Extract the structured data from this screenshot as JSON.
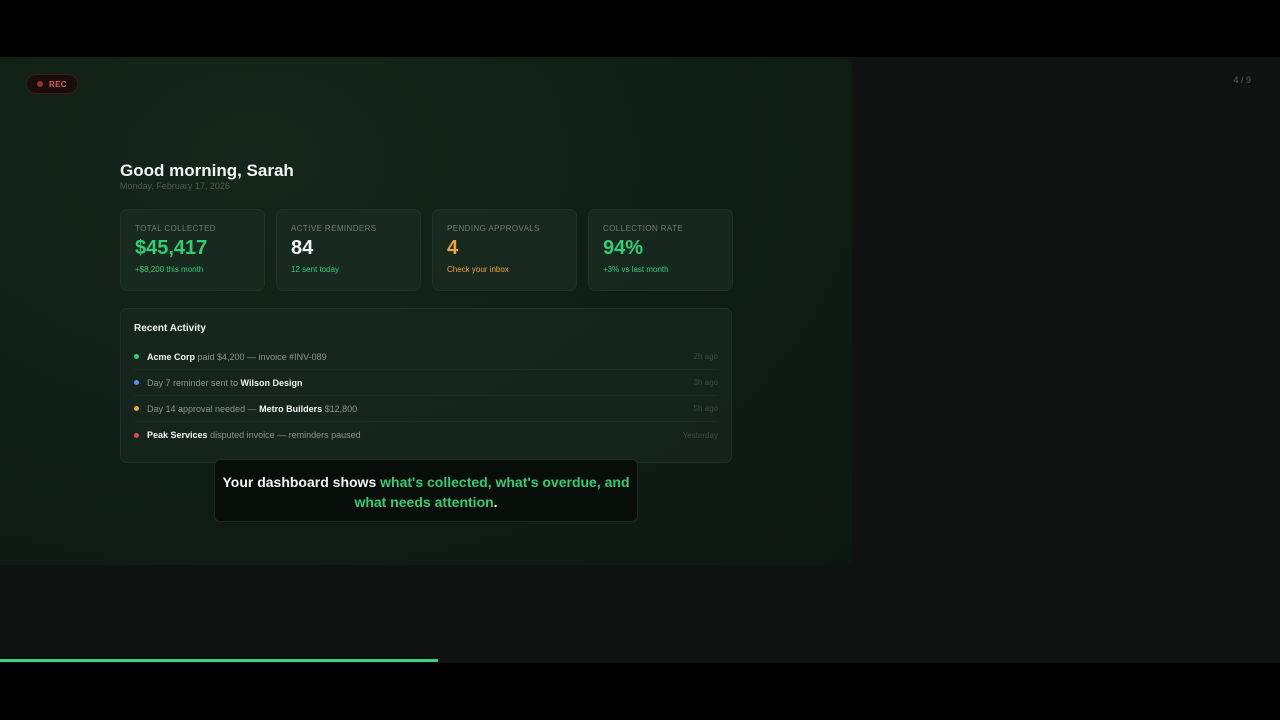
{
  "recording": {
    "label": "REC"
  },
  "slide_counter": "4 / 9",
  "header": {
    "greeting": "Good morning, Sarah",
    "date": "Monday, February 17, 2026"
  },
  "stats": [
    {
      "label": "TOTAL COLLECTED",
      "value": "$45,417",
      "sub": "+$8,200 this month",
      "accent": "#2fcf74"
    },
    {
      "label": "ACTIVE REMINDERS",
      "value": "84",
      "sub": "12 sent today",
      "accent": "#2fcf74"
    },
    {
      "label": "PENDING APPROVALS",
      "value": "4",
      "sub": "Check your inbox",
      "accent": "#f0a53a"
    },
    {
      "label": "COLLECTION RATE",
      "value": "94%",
      "sub": "+3% vs last month",
      "accent": "#2fcf74"
    }
  ],
  "activity": {
    "title": "Recent Activity",
    "items": [
      {
        "dot_color": "#2fcf74",
        "pre": "",
        "bold1": "Acme Corp",
        "mid": " paid $4,200 — invoice #INV-089",
        "bold2": "",
        "post": "",
        "time": "2h ago"
      },
      {
        "dot_color": "#5b8def",
        "pre": "Day 7 reminder sent to ",
        "bold1": "Wilson Design",
        "mid": "",
        "bold2": "",
        "post": "",
        "time": "3h ago"
      },
      {
        "dot_color": "#f0a53a",
        "pre": "Day 14 approval needed — ",
        "bold1": "Metro Builders",
        "mid": " $12,800",
        "bold2": "",
        "post": "",
        "time": "5h ago"
      },
      {
        "dot_color": "#e04848",
        "pre": "",
        "bold1": "Peak Services",
        "mid": " disputed invoice — reminders paused",
        "bold2": "",
        "post": "",
        "time": "Yesterday"
      }
    ]
  },
  "caption": {
    "part1": "Your dashboard shows ",
    "highlight": "what's collected, what's overdue, and what needs attention",
    "part2": "."
  },
  "progress": {
    "fraction": 0.342,
    "color": "#3fcf7c"
  }
}
